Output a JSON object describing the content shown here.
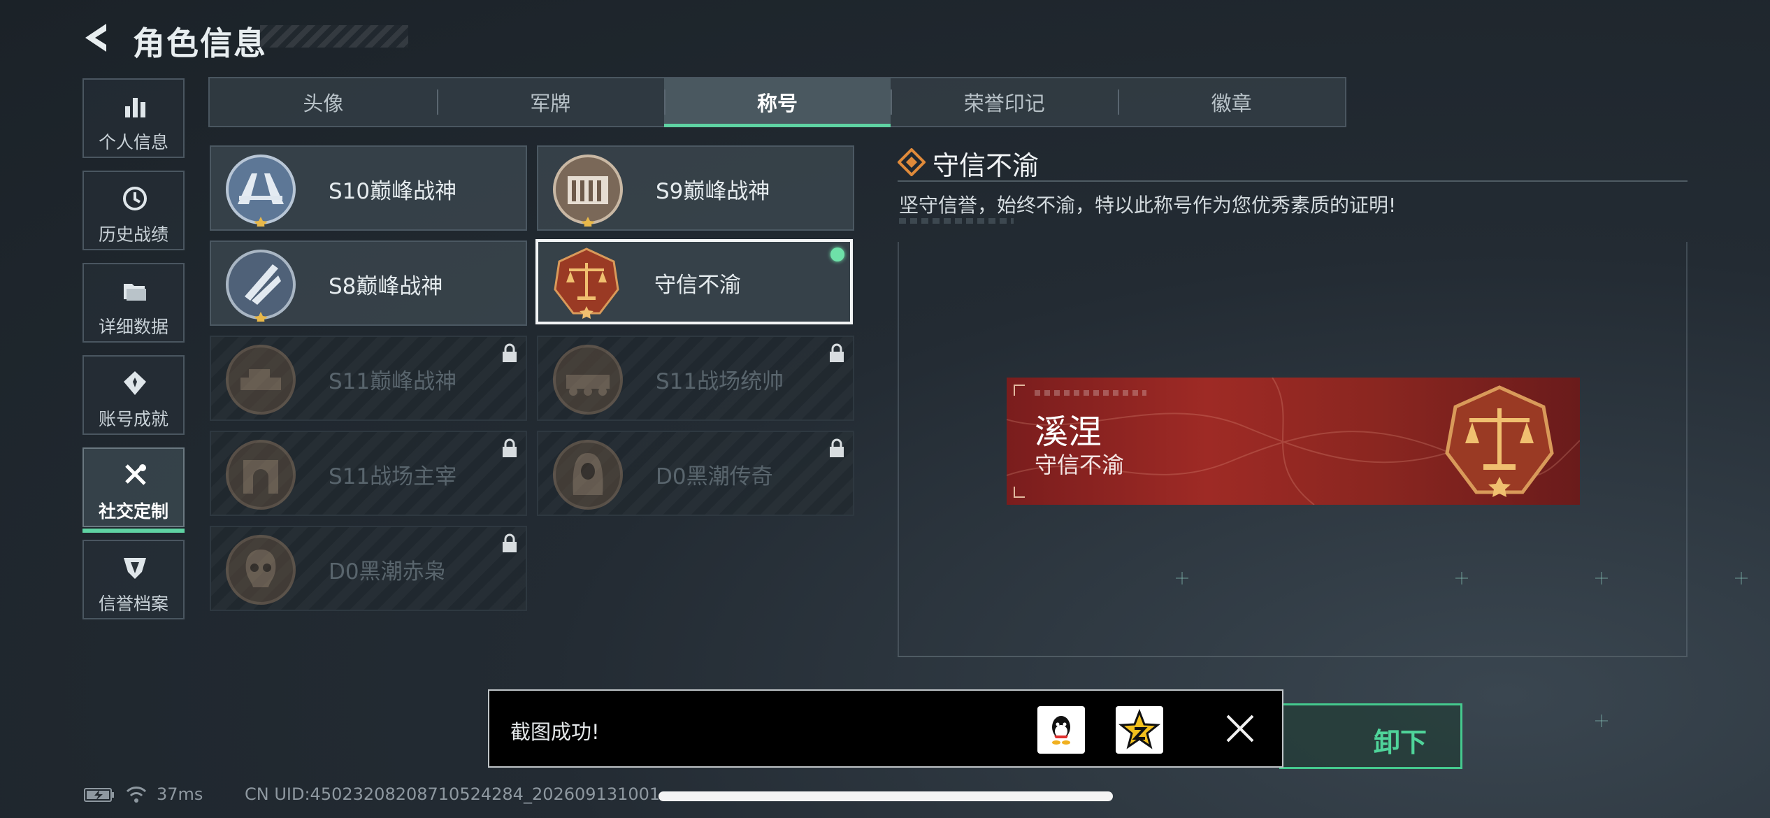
{
  "header": {
    "title": "角色信息"
  },
  "nav": {
    "items": [
      {
        "label": "个人信息",
        "icon": "bar-chart-icon"
      },
      {
        "label": "历史战绩",
        "icon": "history-clock-icon"
      },
      {
        "label": "详细数据",
        "icon": "folder-icon"
      },
      {
        "label": "账号成就",
        "icon": "achievement-icon"
      },
      {
        "label": "社交定制",
        "icon": "tools-icon",
        "active": true
      },
      {
        "label": "信誉档案",
        "icon": "shield-icon"
      }
    ]
  },
  "tabs": [
    {
      "label": "头像"
    },
    {
      "label": "军牌"
    },
    {
      "label": "称号",
      "active": true
    },
    {
      "label": "荣誉印记"
    },
    {
      "label": "徽章"
    }
  ],
  "titles": [
    {
      "name": "S10巅峰战神",
      "locked": false,
      "emblem": "bridge-emblem-icon"
    },
    {
      "name": "S9巅峰战神",
      "locked": false,
      "emblem": "building-emblem-icon"
    },
    {
      "name": "S8巅峰战神",
      "locked": false,
      "emblem": "rocket-emblem-icon"
    },
    {
      "name": "守信不渝",
      "locked": false,
      "selected": true,
      "emblem": "scales-emblem-icon"
    },
    {
      "name": "S11巅峰战神",
      "locked": true,
      "emblem": "tank-emblem-icon"
    },
    {
      "name": "S11战场统帅",
      "locked": true,
      "emblem": "vehicle-emblem-icon"
    },
    {
      "name": "S11战场主宰",
      "locked": true,
      "emblem": "arch-emblem-icon"
    },
    {
      "name": "D0黑潮传奇",
      "locked": true,
      "emblem": "hooded-figure-emblem-icon"
    },
    {
      "name": "D0黑潮赤枭",
      "locked": true,
      "emblem": "skull-emblem-icon"
    }
  ],
  "detail": {
    "title": "守信不渝",
    "description": "坚守信誉，始终不渝，特以此称号作为您优秀素质的证明!",
    "banner": {
      "player_name": "溪涅",
      "title": "守信不渝"
    }
  },
  "equip_button": {
    "label_partial": "卸下"
  },
  "toast": {
    "message": "截图成功!",
    "share_icons": [
      "qq-icon",
      "qzone-star-icon"
    ]
  },
  "status": {
    "ping": "37ms",
    "uid": "CN UID:4502320820871052428​4_202609131001"
  },
  "colors": {
    "accent_green": "#5fd3a3",
    "banner_red": "#9e2a25",
    "background": "#232b33"
  }
}
